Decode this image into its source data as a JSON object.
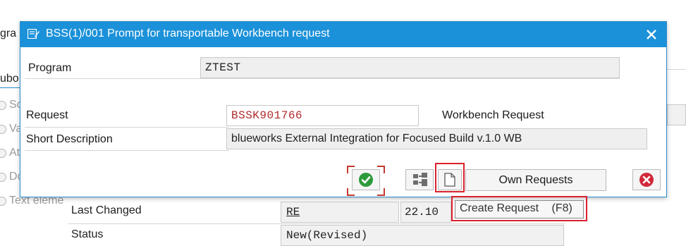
{
  "background": {
    "top_left_text": "gra",
    "sub_text": "ubo",
    "radio_labels": [
      "So",
      "Va",
      "At",
      "Do",
      "Text eleme"
    ],
    "last_changed_label": "Last Changed",
    "last_changed_value": "RE",
    "last_changed_date": "22.10",
    "status_label": "Status",
    "status_value": "New(Revised)"
  },
  "dialog": {
    "title": "BSS(1)/001 Prompt for transportable Workbench request",
    "title_icon": "document-edit-icon",
    "close_icon": "close-icon",
    "program_label": "Program",
    "program_value": "ZTEST",
    "request_label": "Request",
    "request_value": "BSSK901766",
    "request_type": "Workbench Request",
    "short_desc_label": "Short Description",
    "short_desc_value": "blueworks External Integration for Focused Build v.1.0 WB",
    "buttons": {
      "continue_icon": "checkmark-icon",
      "hierarchy_icon": "hierarchy-icon",
      "create_icon": "new-document-icon",
      "own_requests": "Own Requests",
      "cancel_icon": "cancel-icon"
    }
  },
  "tooltip": {
    "text": "Create Request",
    "shortcut": "(F8)"
  },
  "colors": {
    "titlebar": "#1b91d9",
    "highlight": "#d9212e",
    "request_text": "#b02a2a",
    "confirm_green": "#2e9a3b",
    "cancel_red": "#d1283a"
  }
}
